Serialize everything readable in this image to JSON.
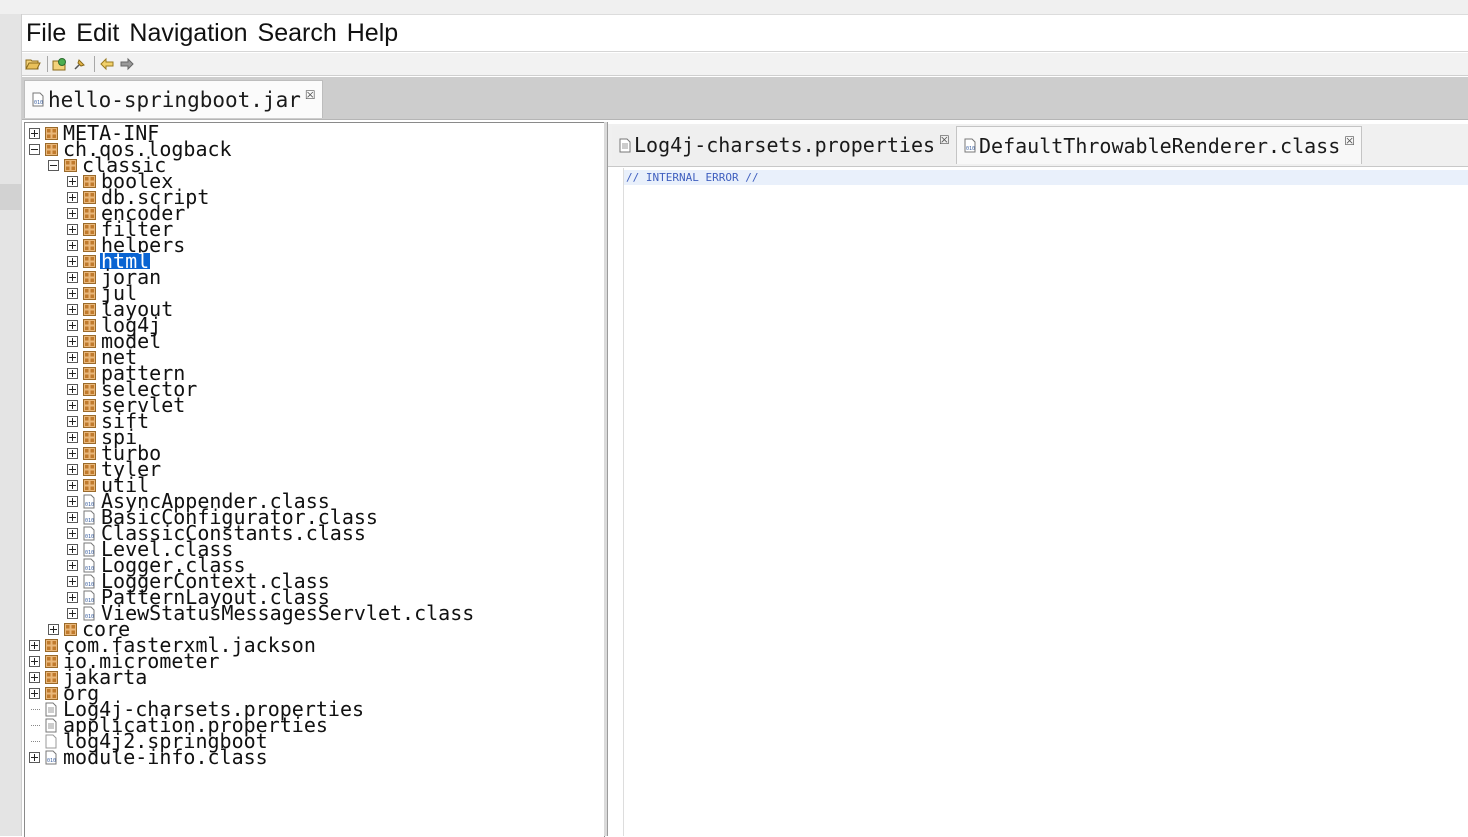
{
  "menu": {
    "items": [
      "File",
      "Edit",
      "Navigation",
      "Search",
      "Help"
    ]
  },
  "toolbar": {
    "buttons": [
      "open-file-icon",
      "open-type-icon",
      "pin-icon",
      "back-arrow-icon",
      "forward-arrow-icon"
    ]
  },
  "file_tab": {
    "label": "hello-springboot.jar",
    "close": "☒"
  },
  "editor": {
    "tabs": [
      {
        "label": "Log4j-charsets.properties",
        "close": "☒",
        "icon": "properties-file-icon"
      },
      {
        "label": "DefaultThrowableRenderer.class",
        "close": "☒",
        "icon": "class-file-icon"
      }
    ],
    "code": "// INTERNAL ERROR //"
  },
  "tree": [
    {
      "label": "META-INF",
      "depth": 0,
      "toggle": "plus",
      "icon": "package-icon"
    },
    {
      "label": "ch.qos.logback",
      "depth": 0,
      "toggle": "minus",
      "icon": "package-icon"
    },
    {
      "label": "classic",
      "depth": 1,
      "toggle": "minus",
      "icon": "package-icon"
    },
    {
      "label": "boolex",
      "depth": 2,
      "toggle": "plus",
      "icon": "package-icon"
    },
    {
      "label": "db.script",
      "depth": 2,
      "toggle": "plus",
      "icon": "package-icon"
    },
    {
      "label": "encoder",
      "depth": 2,
      "toggle": "plus",
      "icon": "package-icon"
    },
    {
      "label": "filter",
      "depth": 2,
      "toggle": "plus",
      "icon": "package-icon"
    },
    {
      "label": "helpers",
      "depth": 2,
      "toggle": "plus",
      "icon": "package-icon"
    },
    {
      "label": "html",
      "depth": 2,
      "toggle": "plus",
      "icon": "package-icon",
      "selected": true
    },
    {
      "label": "joran",
      "depth": 2,
      "toggle": "plus",
      "icon": "package-icon"
    },
    {
      "label": "jul",
      "depth": 2,
      "toggle": "plus",
      "icon": "package-icon"
    },
    {
      "label": "layout",
      "depth": 2,
      "toggle": "plus",
      "icon": "package-icon"
    },
    {
      "label": "log4j",
      "depth": 2,
      "toggle": "plus",
      "icon": "package-icon"
    },
    {
      "label": "model",
      "depth": 2,
      "toggle": "plus",
      "icon": "package-icon"
    },
    {
      "label": "net",
      "depth": 2,
      "toggle": "plus",
      "icon": "package-icon"
    },
    {
      "label": "pattern",
      "depth": 2,
      "toggle": "plus",
      "icon": "package-icon"
    },
    {
      "label": "selector",
      "depth": 2,
      "toggle": "plus",
      "icon": "package-icon"
    },
    {
      "label": "servlet",
      "depth": 2,
      "toggle": "plus",
      "icon": "package-icon"
    },
    {
      "label": "sift",
      "depth": 2,
      "toggle": "plus",
      "icon": "package-icon"
    },
    {
      "label": "spi",
      "depth": 2,
      "toggle": "plus",
      "icon": "package-icon"
    },
    {
      "label": "turbo",
      "depth": 2,
      "toggle": "plus",
      "icon": "package-icon"
    },
    {
      "label": "tyler",
      "depth": 2,
      "toggle": "plus",
      "icon": "package-icon"
    },
    {
      "label": "util",
      "depth": 2,
      "toggle": "plus",
      "icon": "package-icon"
    },
    {
      "label": "AsyncAppender.class",
      "depth": 2,
      "toggle": "plus",
      "icon": "class-file-icon"
    },
    {
      "label": "BasicConfigurator.class",
      "depth": 2,
      "toggle": "plus",
      "icon": "class-file-icon"
    },
    {
      "label": "ClassicConstants.class",
      "depth": 2,
      "toggle": "plus",
      "icon": "class-file-icon"
    },
    {
      "label": "Level.class",
      "depth": 2,
      "toggle": "plus",
      "icon": "class-file-icon"
    },
    {
      "label": "Logger.class",
      "depth": 2,
      "toggle": "plus",
      "icon": "class-file-icon"
    },
    {
      "label": "LoggerContext.class",
      "depth": 2,
      "toggle": "plus",
      "icon": "class-file-icon"
    },
    {
      "label": "PatternLayout.class",
      "depth": 2,
      "toggle": "plus",
      "icon": "class-file-icon"
    },
    {
      "label": "ViewStatusMessagesServlet.class",
      "depth": 2,
      "toggle": "plus",
      "icon": "class-file-icon"
    },
    {
      "label": "core",
      "depth": 1,
      "toggle": "plus",
      "icon": "package-icon"
    },
    {
      "label": "com.fasterxml.jackson",
      "depth": 0,
      "toggle": "plus",
      "icon": "package-icon"
    },
    {
      "label": "io.micrometer",
      "depth": 0,
      "toggle": "plus",
      "icon": "package-icon"
    },
    {
      "label": "jakarta",
      "depth": 0,
      "toggle": "plus",
      "icon": "package-icon"
    },
    {
      "label": "org",
      "depth": 0,
      "toggle": "plus",
      "icon": "package-icon"
    },
    {
      "label": "Log4j-charsets.properties",
      "depth": 0,
      "toggle": "none",
      "icon": "properties-file-icon"
    },
    {
      "label": "application.properties",
      "depth": 0,
      "toggle": "none",
      "icon": "properties-file-icon"
    },
    {
      "label": "log4j2.springboot",
      "depth": 0,
      "toggle": "none",
      "icon": "blank-file-icon"
    },
    {
      "label": "module-info.class",
      "depth": 0,
      "toggle": "plus",
      "icon": "class-file-icon"
    }
  ]
}
